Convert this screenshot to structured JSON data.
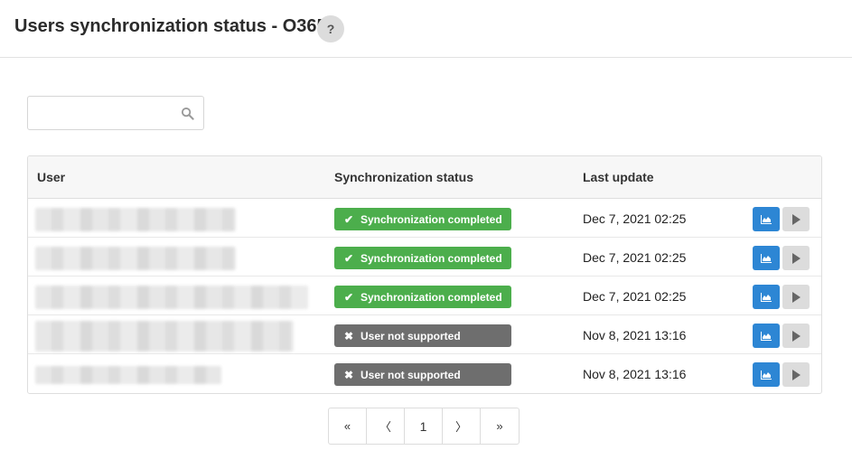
{
  "header": {
    "title": "Users synchronization status - O365",
    "help_label": "?"
  },
  "search": {
    "value": "",
    "placeholder": ""
  },
  "table": {
    "columns": [
      "User",
      "Synchronization status",
      "Last update"
    ],
    "rows": [
      {
        "user": "",
        "status": "Synchronization completed",
        "status_type": "success",
        "last_update": "Dec 7, 2021 02:25"
      },
      {
        "user": "",
        "status": "Synchronization completed",
        "status_type": "success",
        "last_update": "Dec 7, 2021 02:25"
      },
      {
        "user": "",
        "status": "Synchronization completed",
        "status_type": "success",
        "last_update": "Dec 7, 2021 02:25"
      },
      {
        "user": "",
        "status": "User not supported",
        "status_type": "unsupported",
        "last_update": "Nov 8, 2021 13:16"
      },
      {
        "user": "",
        "status": "User not supported",
        "status_type": "unsupported",
        "last_update": "Nov 8, 2021 13:16"
      }
    ]
  },
  "pagination": {
    "first": "«",
    "prev": "〈",
    "current": "1",
    "next": "〉",
    "last": "»"
  },
  "colors": {
    "success": "#4cae4c",
    "unsupported": "#6e6e6e",
    "primary": "#2d86d4"
  }
}
